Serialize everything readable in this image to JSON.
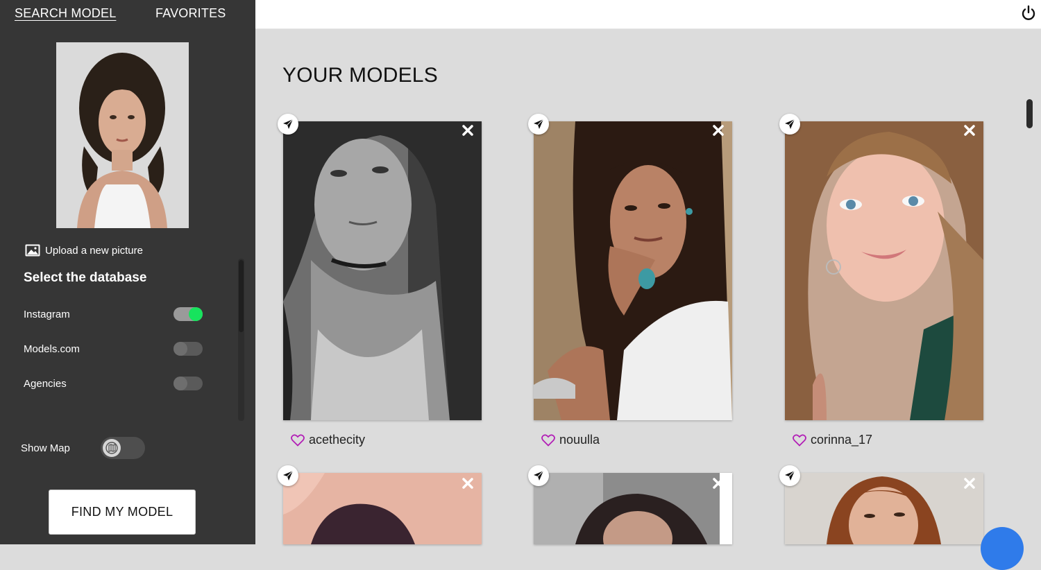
{
  "sidebar": {
    "tabs": [
      {
        "label": "SEARCH MODEL",
        "active": true
      },
      {
        "label": "FAVORITES",
        "active": false
      }
    ],
    "upload_label": "Upload a new picture",
    "db_title": "Select the database",
    "databases": [
      {
        "label": "Instagram",
        "enabled": true
      },
      {
        "label": "Models.com",
        "enabled": false
      },
      {
        "label": "Agencies",
        "enabled": false
      }
    ],
    "show_map_label": "Show Map",
    "show_map_enabled": false,
    "find_button": "FIND MY MODEL"
  },
  "header": {
    "power_icon": "power-icon"
  },
  "main": {
    "title": "YOUR MODELS",
    "models": [
      {
        "name": "acethecity"
      },
      {
        "name": "nouulla"
      },
      {
        "name": "corinna_17"
      },
      {
        "name": ""
      },
      {
        "name": ""
      },
      {
        "name": ""
      }
    ]
  },
  "colors": {
    "sidebar_bg": "#363636",
    "main_bg": "#dcdcdc",
    "toggle_on": "#17e35d",
    "heart": "#b21fb6",
    "chat": "#2f7bea"
  }
}
